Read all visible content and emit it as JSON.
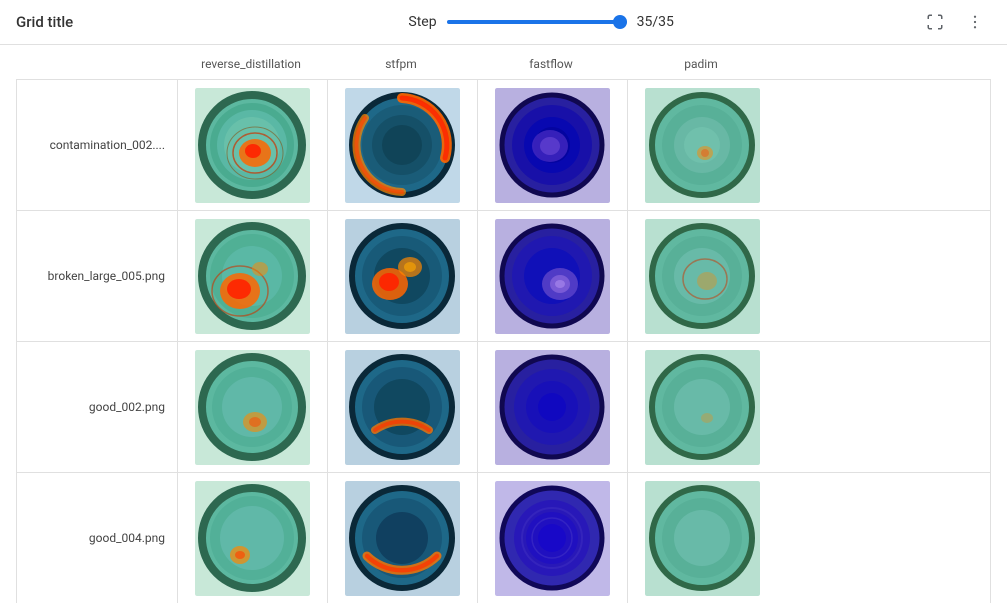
{
  "header": {
    "title": "Grid title",
    "step_label": "Step",
    "step_value": "35/35",
    "step_min": 1,
    "step_max": 35,
    "step_current": 35
  },
  "columns": [
    {
      "id": "reverse_distillation",
      "label": "reverse_distillation"
    },
    {
      "id": "stfpm",
      "label": "stfpm"
    },
    {
      "id": "fastflow",
      "label": "fastflow"
    },
    {
      "id": "padim",
      "label": "padim"
    }
  ],
  "rows": [
    {
      "id": "contamination_002",
      "label": "contamination_002...."
    },
    {
      "id": "broken_large_005",
      "label": "broken_large_005.png"
    },
    {
      "id": "good_002",
      "label": "good_002.png"
    },
    {
      "id": "good_004",
      "label": "good_004.png"
    }
  ],
  "toolbar": {
    "fullscreen_title": "Fullscreen",
    "more_title": "More options"
  }
}
